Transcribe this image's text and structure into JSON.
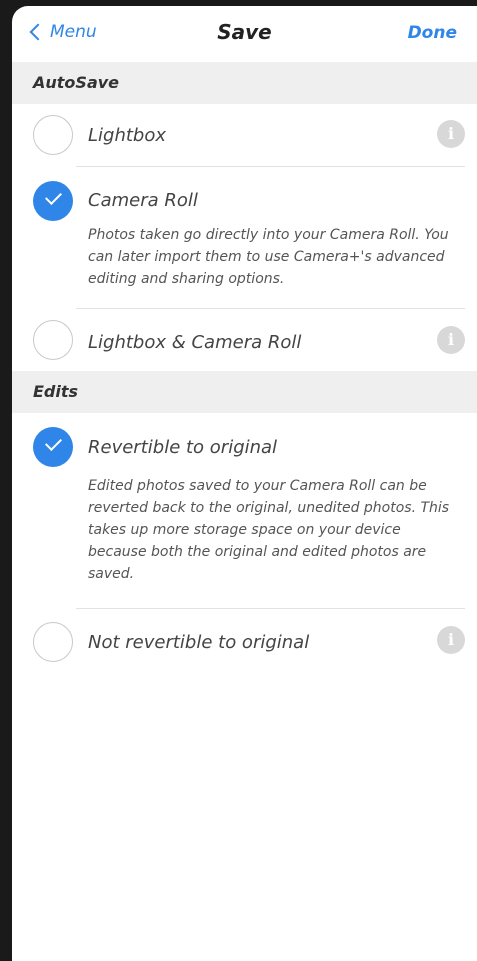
{
  "nav": {
    "back_label": "Menu",
    "title": "Save",
    "done_label": "Done"
  },
  "sections": {
    "autosave": {
      "header": "AutoSave",
      "options": [
        {
          "label": "Lightbox",
          "checked": false,
          "description": ""
        },
        {
          "label": "Camera Roll",
          "checked": true,
          "description": "Photos taken go directly into your Camera Roll. You can later import them to use Camera+'s advanced editing and sharing options."
        },
        {
          "label": "Lightbox & Camera Roll",
          "checked": false,
          "description": ""
        }
      ]
    },
    "edits": {
      "header": "Edits",
      "options": [
        {
          "label": "Revertible to original",
          "checked": true,
          "description": "Edited photos saved to your Camera Roll can be reverted back to the original, unedited photos. This takes up more storage space on your device because both the original and edited photos are saved."
        },
        {
          "label": "Not revertible to original",
          "checked": false,
          "description": ""
        }
      ]
    }
  },
  "icons": {
    "info": "i",
    "back": "chevron-left-icon",
    "check": "checkmark-icon"
  },
  "colors": {
    "accent": "#2f86e8",
    "section_bg": "#efefef"
  }
}
